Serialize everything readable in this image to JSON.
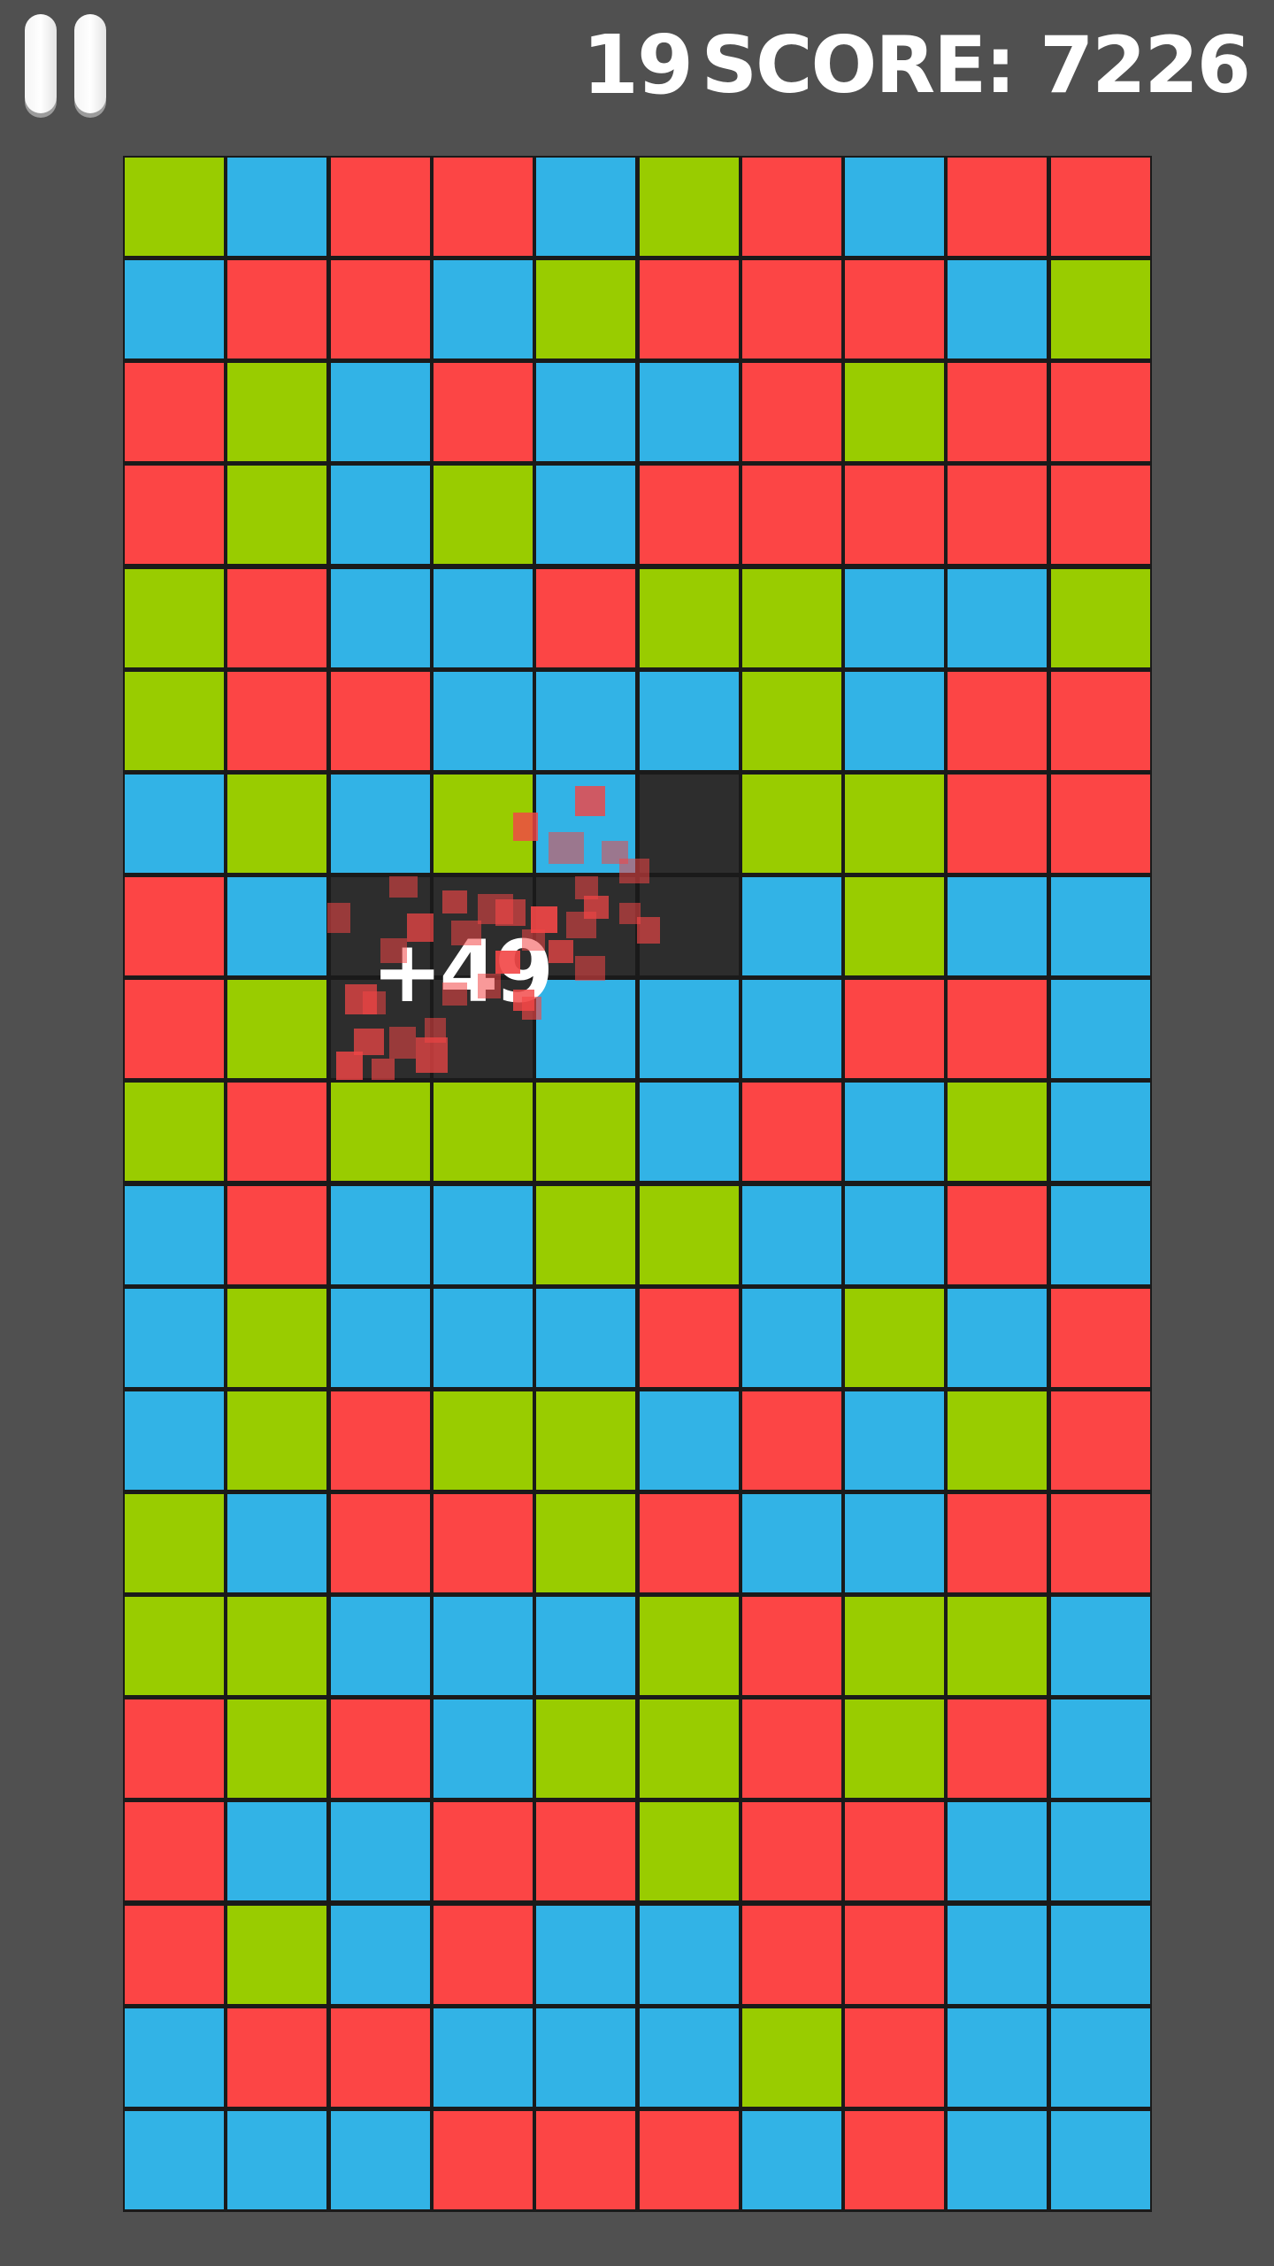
{
  "hud": {
    "pause_icon": "pause-icon",
    "moves": "19",
    "score": "SCORE: 7226"
  },
  "popup": {
    "text": "+49"
  },
  "colors": {
    "background": "#505050",
    "red": "#fc4545",
    "blue": "#32b3e6",
    "green": "#99cc00",
    "cleared": "#2d2d2d",
    "grid_line": "#1a1a1a"
  },
  "board": {
    "columns": 10,
    "rows": [
      "GBRRBGRBRR",
      "BRRBGRRRBG",
      "RGBRBBRGRR",
      "RGBGBRRRRR",
      "GRBBRGGBBG",
      "GRRBBBGBRR",
      "BGBGBEGGRR",
      "RBEEEEBGBB",
      "RGEEBBBRRB",
      "GRGGGBRBGB",
      "BRBBGGBBRB",
      "BGBBBRBGBR",
      "BGRGGBRBGR",
      "GBRRGRBBRR",
      "GGBBBGRGGB",
      "RGRBGGRGRB",
      "RBBRRGRRBB",
      "RGBRBBRRBB",
      "BRRBBBGRBB",
      "BBBRRRBRBB"
    ]
  }
}
